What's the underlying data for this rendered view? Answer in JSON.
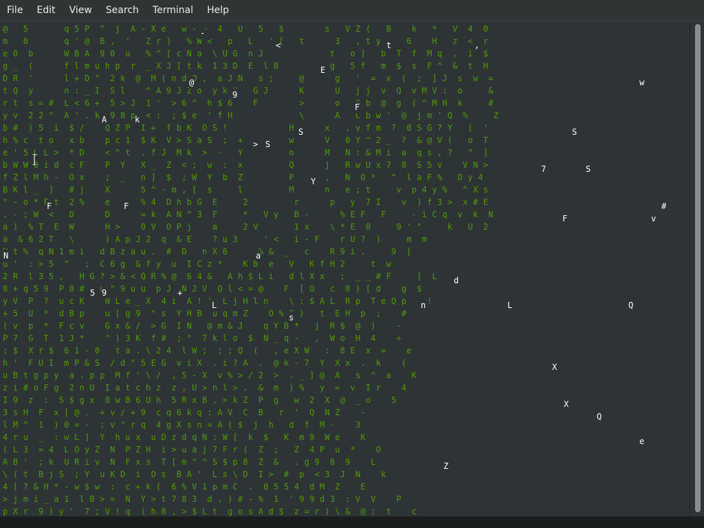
{
  "menubar": {
    "items": [
      "File",
      "Edit",
      "View",
      "Search",
      "Terminal",
      "Help"
    ]
  },
  "terminal": {
    "rain_lines": [
      "@   5       q 5 P  \"  j  A - X e   w - ~  4   U   5   $        s   V Z (   B    k   *   V  4  0",
      "m   0       q ' @  B ,  '   Z r )   % W <   p   L   ' [   t      3   , t y -   6    H   z  <  r",
      "e 0  b      W B A  9 0  u   % ^ [ c N a  \\ U G  n J             t   o ]   b  T  f  M q  ,  i  $",
      "g _  (      f l m u h p  r  _ X J [ t k  1 3 D  E  l 8          g   5 f   m  $  s  F ^  &  t  H",
      "D R  '      l + D \"  2 k  @  M ( n d O ,  a J N   s ;     @      g   '  =  x  (  ;  ] J  s  w  =",
      "t Q  y      n : _ I  S l    ^ A 9 J Z o  y k H   G J      K      U   j j  v  Q  v M V :  o     &",
      "r t  s = #  L < 6 +  5 > J  1 '  > 6 ^  h $ 6    F        >      o   O b  @  g  ( ^ M H  k     #",
      "y v  2 2 \"  A ' . k  9 8 p  < :  ; $ e  ' f H             \\      A   C b w '  @  j m ' Q  %     Z",
      "b #  ) 5  i  $ /    Q Z P  I +  f b K  O S !            H      x   , v f m  ?  0 S G ? Y   (  '",
      "h % c  t o   x b    p c 1  $ K  V > S a S  ;  +         w      V   0 Y ^ 2 _  ?  & @ V (   o  T",
      "e ' 5 L L >  * D    < ^ t  . f J  M k  >  -   Y         o      M   N : & M i  a  q s , ?   \"  ]",
      "b W W 0 i d  c F    P  Y   X _  Z  < ;  w  :  x         Q      j   R w U x 7  8  S 5 v    V N >",
      "f Z l M h -  O x    ;  _   n ]  $  ; W  Y  b  Z         P      ,   N  O *   ^  l a F %   D y 4",
      "B K l _  ]   # j    X      5 ^ - m , [  s     l         M      n   e ; t     v  p 4 y %   ^ X s",
      "\" - o * F t  2 %    e      % 4  D h b G  E     2         r      p   y  7 I    v  ) f 3 >  x # E",
      ". - ; W  <   D      D      = k  A N ^ 3  F     *   V y   B -      % E F   F     - i C q  v  k  N",
      "a )  % T  E  W      H >    0 V  O P j    a     2 V       1 x    \\ * E  0     9 ' \"     k   U  2",
      "a  & 6 2 T   \\      ) A p J 2  q  & E    ? u 3     ' <   i - F    r U ?  )     m  m",
      "N t %  q N 1 m i   d B z a u .  #  D   n X 6      % &  _   c    R 9 i .     9  [",
      "G '  : > 5  \"   ;  C 6 g  & f y  u  I C z *    K B  e   V   K f H 2     t  w",
      "2 R  l 3 5 ,   H G ? > & < Q R % @  6 4 &   A h $ L i   d l X x   ;  _ _ # F     [  L",
      "8 + q 5 9  P 8 # + o \" 9 u u  p J  N J V  Q l < = @    F  [ O   c  8 ) [ d    g  $",
      "y V  P  ?  u c K    N L e _ X  4 i  A ! '  L j H l n    \\ : $ A L  R p  T e Q p    !",
      "+ 5  U  *  d B p    u [ g 9  \" s  Y H B  u q m Z    O % P )   t  E H  p  ;    #",
      "( v  p  *  F c v    G x & /  > G  I N   @ m & J    q Y B *   j  R $  @  )    -",
      "P 7  G  T  1 J *    ^ ) 3 K  f #  ; \"  7 k l o  $  N _ q -   ,  W o  H  4    +",
      ": $  X r $  6 1 - 0   t a . \\ 2 4  l W ;  ; ; Q  (   , e X W   :  8 E  x  =    e",
      "h '  F U I  m P & S  / d \" 5 E G  v i X  . i ? A  .  @ k - 7  Y  X x  .  k    (",
      "u B t g p y  a . p p  M f ' \\ /  , 5 - X  v % > / 2  >  . _ ] @  A   s  ^  a    K",
      "z i # o F g  2 n U  I a t c h z  z , U > n l > .  &  m  ) %   y  =  v  I r    4",
      "I 9  z  :  S $ g x  0 w B 6 U h  5 R x B , > k Z  P  g   w  2  X  @  _ o    5",
      "3 s H  F  x [ @ .  + v / + 9  c q 6 k q : A V  C  B   r  '  Q  N Z    -",
      "l M ^  1  ) 0 = -  ; v \" r q  4 g X s n = A ( $  j  h   d  f  M -    3",
      "4 r u  _  : w L ]  Y  h u x  u D z d q N : W [  k  $   K  m 9  W e    K",
      "( L 3  = 4  L O y Z  N  P Z H  i > u a j 7 F r (  Z  ;   Z  4 P  u  *    O",
      "A B '  ; k  U R i v  N  F x s  T [ m \" ^ S $ p 8  Z  &   . g 9  8  9    L",
      "\\ ( t  B j S  ; Y  u K D  i  O s  B A '  L s \\ D  I >  #  p  < 3  J  N    k",
      "4 [ ? & H * - w $ w  :  c + k [  6 % V 1 p m C  .  0 5 5 4  d M  Z    E",
      "> j m i _ a 1  l B > =  N  Y > t 7 8 3  d , ) # - %  1  ' 9 9 d 3  : V  V    P",
      "p X r  9 ) y '  7 ; V ! q  ( h 8 , > $ L t  g o s A d $  z = r ) \\ &  @ ;  t    c"
    ],
    "highlights": [
      {
        "char": "-"
      },
      {
        "char": "<"
      },
      {
        "char": "t"
      },
      {
        "char": ","
      },
      {
        "char": "E"
      },
      {
        "char": "@"
      },
      {
        "char": "w"
      },
      {
        "char": "9"
      },
      {
        "char": "F"
      },
      {
        "char": "A"
      },
      {
        "char": "k"
      },
      {
        "char": "S"
      },
      {
        "char": "S"
      },
      {
        "char": ">"
      },
      {
        "char": "S"
      },
      {
        "char": "7"
      },
      {
        "char": "S"
      },
      {
        "char": "Y"
      },
      {
        "char": "F"
      },
      {
        "char": "#"
      },
      {
        "char": "F"
      },
      {
        "char": "v"
      },
      {
        "char": "F"
      },
      {
        "char": "a"
      },
      {
        "char": "N"
      },
      {
        "char": "d"
      },
      {
        "char": "5"
      },
      {
        "char": "9"
      },
      {
        "char": "+"
      },
      {
        "char": "L"
      },
      {
        "char": "n"
      },
      {
        "char": "L"
      },
      {
        "char": "Q"
      },
      {
        "char": "s"
      },
      {
        "char": "X"
      },
      {
        "char": "X"
      },
      {
        "char": "Q"
      },
      {
        "char": "e"
      },
      {
        "char": "Z"
      }
    ]
  }
}
